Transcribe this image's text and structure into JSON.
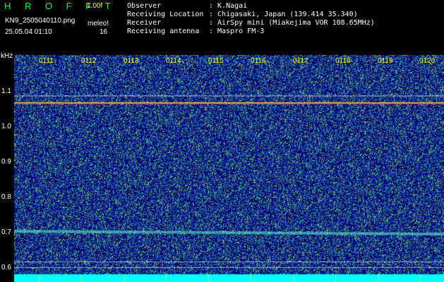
{
  "header": {
    "logo": "H R O F F T",
    "version": "1.00f",
    "filename": "KN9_2505040110.png",
    "meleo": "meleo!",
    "datetime": "25.05.04 01:10",
    "count": "16"
  },
  "info": [
    {
      "label": "Observer",
      "value": ": K.Nagai"
    },
    {
      "label": "Receiving Location",
      "value": ": Chigasaki, Japan (139.414 35.340)"
    },
    {
      "label": "Receiver",
      "value": ": AirSpy mini (Miakejima VOR 108.65MHz)"
    },
    {
      "label": "Receiving antenna",
      "value": ": Maspro FM-3"
    }
  ],
  "axis": {
    "unit": "kHz",
    "freq_ticks": [
      "1.1",
      "1.0",
      "0.9",
      "0.8",
      "0.7",
      "0.6"
    ],
    "time_ticks": [
      "0111",
      "0112",
      "0113",
      "0114",
      "0115",
      "0116",
      "0117",
      "0118",
      "0119",
      "0120"
    ]
  },
  "colors": {
    "background": "#000000",
    "logo": "#00ff44",
    "time_label": "#ffff00",
    "baseline": "#00ffff"
  }
}
